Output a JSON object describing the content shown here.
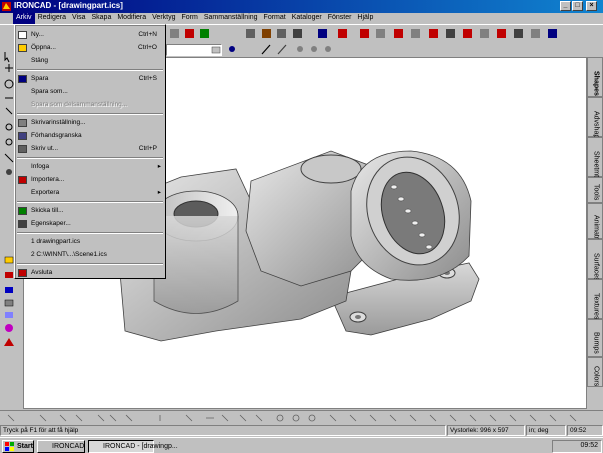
{
  "window": {
    "title": "IRONCAD - [drawingpart.ics]"
  },
  "menubar": [
    "Arkiv",
    "Redigera",
    "Visa",
    "Skapa",
    "Modifiera",
    "Verktyg",
    "Form",
    "Sammanställning",
    "Format",
    "Kataloger",
    "Fönster",
    "Hjälp"
  ],
  "file_menu": [
    {
      "label": "Ny...",
      "shortcut": "Ctrl+N",
      "icon": "new-icon"
    },
    {
      "label": "Öppna...",
      "shortcut": "Ctrl+O",
      "icon": "open-icon"
    },
    {
      "label": "Stäng",
      "shortcut": "",
      "icon": ""
    },
    {
      "label": "Spara",
      "shortcut": "Ctrl+S",
      "icon": "save-icon"
    },
    {
      "label": "Spara som...",
      "shortcut": "",
      "icon": ""
    },
    {
      "label": "Spara som delsammanställning...",
      "shortcut": "",
      "icon": "",
      "disabled": true
    },
    {
      "label": "Skrivarinställning...",
      "shortcut": "",
      "icon": "printer-setup-icon"
    },
    {
      "label": "Förhandsgranska",
      "shortcut": "",
      "icon": "print-preview-icon"
    },
    {
      "label": "Skriv ut...",
      "shortcut": "Ctrl+P",
      "icon": "print-icon"
    },
    {
      "label": "Infoga",
      "shortcut": "",
      "icon": "",
      "submenu": true
    },
    {
      "label": "Importera...",
      "shortcut": "",
      "icon": "import-icon"
    },
    {
      "label": "Exportera",
      "shortcut": "",
      "icon": "",
      "submenu": true
    },
    {
      "label": "Skicka till...",
      "shortcut": "",
      "icon": "send-icon"
    },
    {
      "label": "Egenskaper...",
      "shortcut": "",
      "icon": "properties-icon"
    },
    {
      "label": "1 drawingpart.ics",
      "shortcut": "",
      "icon": ""
    },
    {
      "label": "2 C:\\WINNT\\...\\Scene1.ics",
      "shortcut": "",
      "icon": ""
    },
    {
      "label": "Avsluta",
      "shortcut": "",
      "icon": "exit-icon"
    }
  ],
  "right_tabs": [
    "Shapes",
    "Advshapes",
    "Sheetmtl",
    "Tools",
    "Animatn",
    "Surfaces",
    "Textures",
    "Bumps",
    "Colors"
  ],
  "status": {
    "help": "Tryck på F1 för att få hjälp",
    "viewsize": "Vystorlek: 996 x 597",
    "units": "in; deg",
    "time": "09:52"
  },
  "taskbar": {
    "start": "Start",
    "tasks": [
      "IRONCAD",
      "IRONCAD - [drawingp..."
    ],
    "time": "09:52"
  },
  "colors": {
    "titlebar": "#000080",
    "chrome": "#c0c0c0",
    "viewport": "#ffffff"
  }
}
